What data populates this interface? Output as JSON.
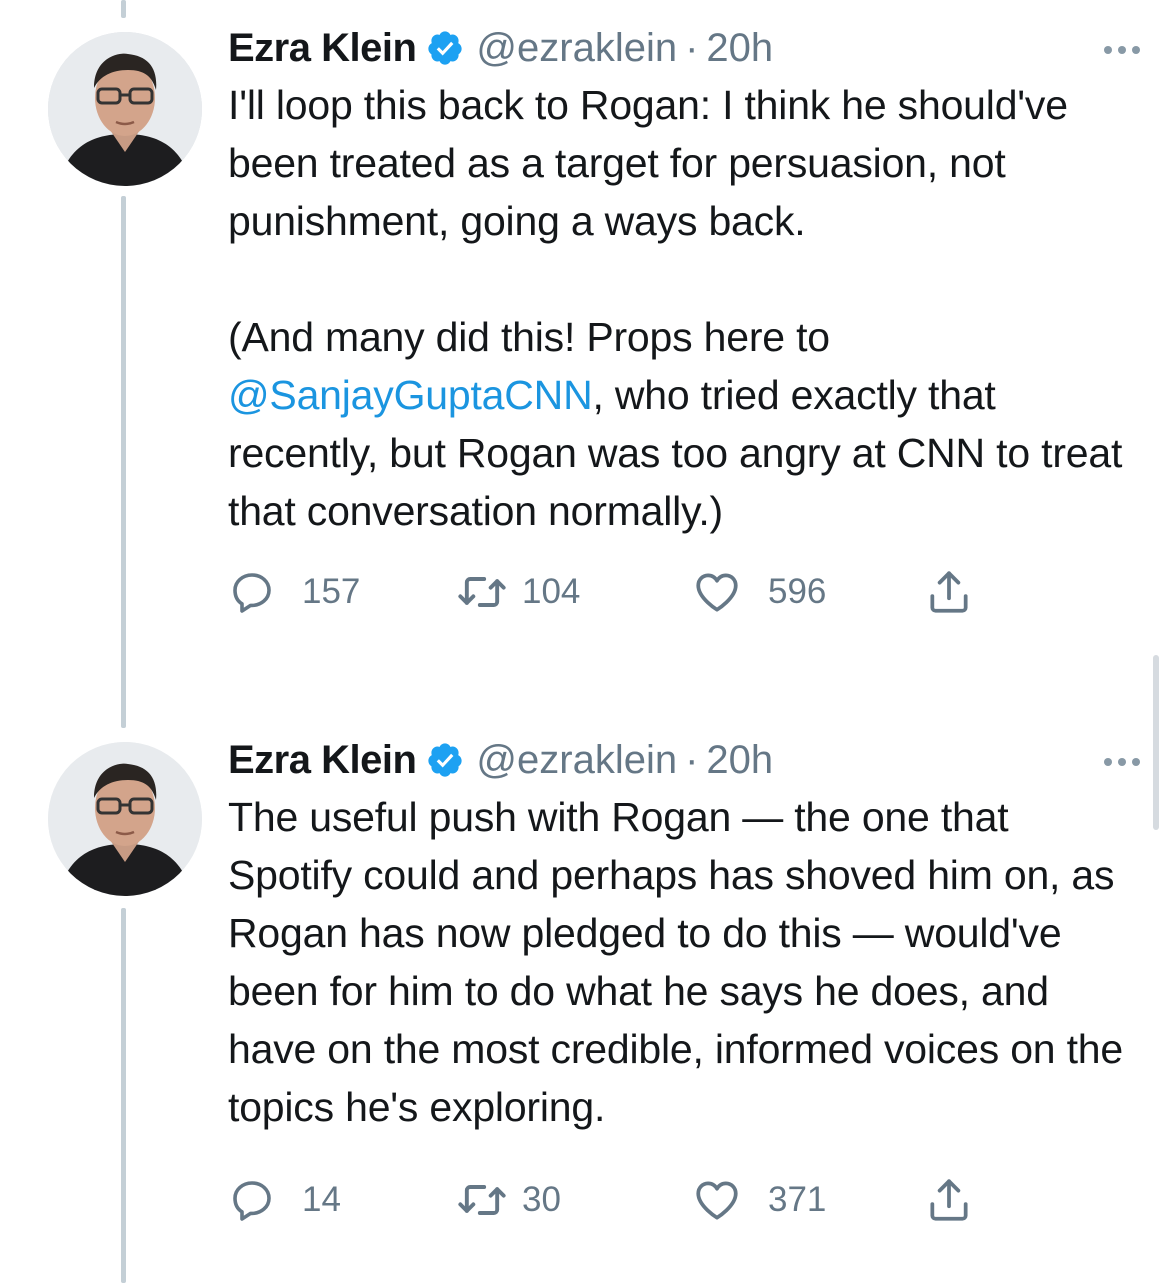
{
  "tweets": [
    {
      "author_name": "Ezra Klein",
      "handle": "@ezraklein",
      "separator": "·",
      "time": "20h",
      "text_before": "I'll loop this back to Rogan: I think he should've been treated as a target for persuasion, not punishment, going a ways back.\n\n(And many did this! Props here to ",
      "mention": "@SanjayGuptaCNN",
      "text_after": ", who tried exactly that recently, but Rogan was too angry at CNN to treat that conversation normally.)",
      "replies": "157",
      "retweets": "104",
      "likes": "596"
    },
    {
      "author_name": "Ezra Klein",
      "handle": "@ezraklein",
      "separator": "·",
      "time": "20h",
      "text_before": "The useful push with Rogan — the one that Spotify could and perhaps has shoved him on, as Rogan has now pledged to do this — would've been for him to do what he says he does, and have on the most credible, informed voices on the topics he's exploring.",
      "mention": "",
      "text_after": "",
      "replies": "14",
      "retweets": "30",
      "likes": "371"
    }
  ],
  "icons": {
    "verified": "verified-badge-icon",
    "more": "more-options-icon",
    "reply": "reply-icon",
    "retweet": "retweet-icon",
    "like": "heart-icon",
    "share": "share-icon"
  },
  "colors": {
    "text": "#14171a",
    "secondary": "#657786",
    "link": "#1b95e0",
    "verified": "#1da1f2",
    "thread_line": "#c4cfd6"
  }
}
